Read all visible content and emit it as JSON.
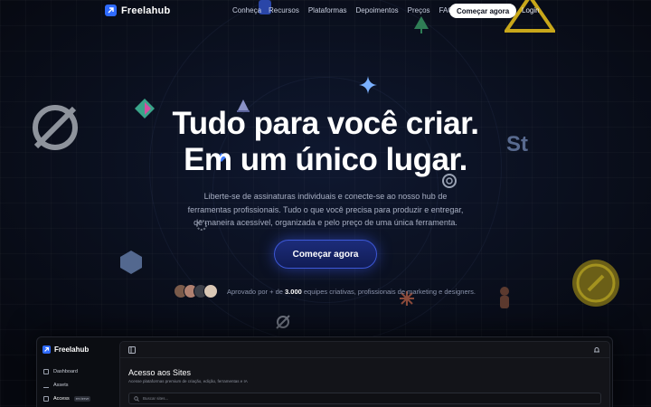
{
  "nav": {
    "brand": "Freelahub",
    "links": [
      "Conheça",
      "Recursos",
      "Plataformas",
      "Depoimentos",
      "Preços",
      "FAQ"
    ],
    "cta_label": "Começar agora",
    "login_label": "Login"
  },
  "hero": {
    "title_line1": "Tudo para você criar.",
    "title_line2": "Em um único lugar.",
    "subtitle_line1": "Liberte-se de assinaturas individuais e conecte-se ao nosso hub de",
    "subtitle_line2": "ferramentas profissionais. Tudo o que você precisa para produzir e entregar,",
    "subtitle_line3": "de maneira acessível, organizada e pelo preço de uma única ferramenta.",
    "cta_label": "Começar agora",
    "approval_prefix": "Aprovado por + de ",
    "approval_count": "3.000",
    "approval_suffix": " equipes criativas, profissionais de marketing e designers."
  },
  "dashboard": {
    "brand": "Freelahub",
    "nav": [
      {
        "label": "Dashboard",
        "icon": "grid-icon"
      },
      {
        "label": "Assets",
        "icon": "download-icon"
      },
      {
        "label": "Access",
        "icon": "monitor-icon",
        "badge": "em breve"
      }
    ],
    "title": "Acesso aos Sites",
    "description": "Acesse plataformas premium de criação, edição, ferramentas e IA",
    "search_placeholder": "Buscar sites..."
  },
  "colors": {
    "accent": "#2f6bff",
    "background": "#0a0f1d",
    "cta_glow": "#3d58d8"
  }
}
